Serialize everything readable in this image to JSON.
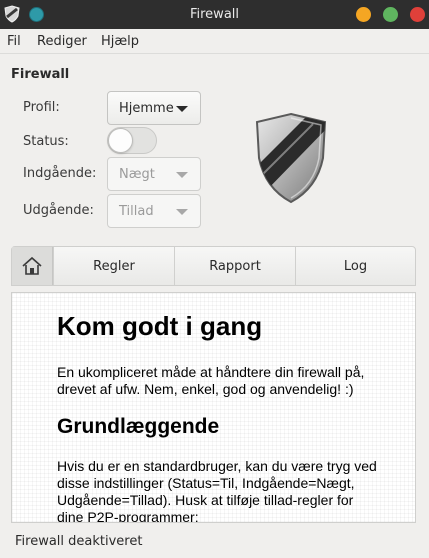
{
  "window": {
    "title": "Firewall",
    "close_color": "#e0403a",
    "minimize_color": "#f5a623",
    "maximize_color": "#5fb55f"
  },
  "menu": {
    "items": [
      {
        "label": "Fil"
      },
      {
        "label": "Rediger"
      },
      {
        "label": "Hjælp"
      }
    ]
  },
  "firewall": {
    "section_title": "Firewall",
    "profile_label": "Profil:",
    "profile_value": "Hjemme",
    "status_label": "Status:",
    "status_on": false,
    "incoming_label": "Indgående:",
    "incoming_value": "Nægt",
    "outgoing_label": "Udgående:",
    "outgoing_value": "Tillad",
    "shield_icon": "shield-icon"
  },
  "tabs": [
    {
      "icon": "home-icon",
      "label": ""
    },
    {
      "label": "Regler"
    },
    {
      "label": "Rapport"
    },
    {
      "label": "Log"
    }
  ],
  "content": {
    "heading": "Kom godt i gang",
    "intro": "En ukompliceret måde at håndtere din firewall på, drevet af ufw. Nem, enkel, god og anvendelig! :)",
    "subheading": "Grundlæggende",
    "basics": "Hvis du er en standardbruger, kan du være tryg ved disse indstillinger (Status=Til, Indgående=Nægt, Udgående=Tillad). Husk at tilføje tillad-regler for dine P2P-programmer:"
  },
  "statusbar": {
    "text": "Firewall deaktiveret"
  }
}
